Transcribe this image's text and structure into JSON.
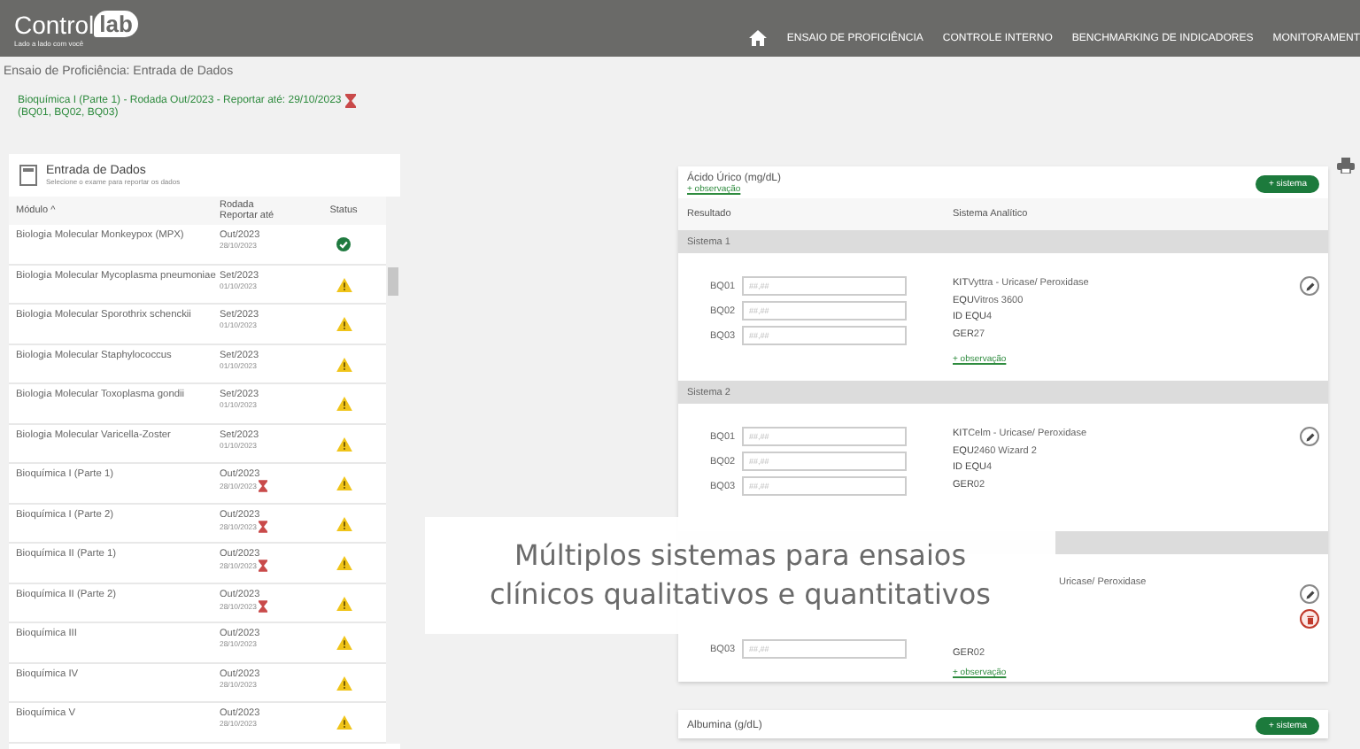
{
  "header": {
    "logo_main": "Control",
    "logo_badge": "lab",
    "tagline": "Lado a lado com você",
    "nav": [
      "ENSAIO DE PROFICIÊNCIA",
      "CONTROLE INTERNO",
      "BENCHMARKING DE INDICADORES",
      "MONITORAMENT"
    ]
  },
  "breadcrumb": "Ensaio de Proficiência: Entrada de Dados",
  "selection": {
    "title": "Bioquímica I (Parte 1) - Rodada Out/2023 - Reportar até: 29/10/2023",
    "deadline_alert": true,
    "samples": "(BQ01, BQ02, BQ03)"
  },
  "panel": {
    "title": "Entrada de Dados",
    "subtitle": "Selecione o exame para reportar os dados",
    "columns": [
      "Módulo ^",
      "Rodada",
      "Reportar até",
      "Status"
    ],
    "rows": [
      {
        "module": "Biologia Molecular Monkeypox (MPX)",
        "round": "Out/2023",
        "date": "28/10/2023",
        "deadline_alert": false,
        "kind": "ok"
      },
      {
        "module": "Biologia Molecular Mycoplasma pneumoniae",
        "round": "Set/2023",
        "date": "01/10/2023",
        "deadline_alert": false,
        "kind": "warning"
      },
      {
        "module": "Biologia Molecular Sporothrix schenckii",
        "round": "Set/2023",
        "date": "01/10/2023",
        "deadline_alert": false,
        "kind": "warning"
      },
      {
        "module": "Biologia Molecular Staphylococcus",
        "round": "Set/2023",
        "date": "01/10/2023",
        "deadline_alert": false,
        "kind": "warning"
      },
      {
        "module": "Biologia Molecular Toxoplasma gondii",
        "round": "Set/2023",
        "date": "01/10/2023",
        "deadline_alert": false,
        "kind": "warning"
      },
      {
        "module": "Biologia Molecular Varicella-Zoster",
        "round": "Set/2023",
        "date": "01/10/2023",
        "deadline_alert": false,
        "kind": "warning"
      },
      {
        "module": "Bioquímica I (Parte 1)",
        "round": "Out/2023",
        "date": "28/10/2023",
        "deadline_alert": true,
        "kind": "warning"
      },
      {
        "module": "Bioquímica I (Parte 2)",
        "round": "Out/2023",
        "date": "28/10/2023",
        "deadline_alert": true,
        "kind": "warning"
      },
      {
        "module": "Bioquímica II (Parte 1)",
        "round": "Out/2023",
        "date": "28/10/2023",
        "deadline_alert": true,
        "kind": "warning"
      },
      {
        "module": "Bioquímica II (Parte 2)",
        "round": "Out/2023",
        "date": "28/10/2023",
        "deadline_alert": true,
        "kind": "warning"
      },
      {
        "module": "Bioquímica III",
        "round": "Out/2023",
        "date": "28/10/2023",
        "deadline_alert": false,
        "kind": "warning"
      },
      {
        "module": "Bioquímica IV",
        "round": "Out/2023",
        "date": "28/10/2023",
        "deadline_alert": false,
        "kind": "warning"
      },
      {
        "module": "Bioquímica V",
        "round": "Out/2023",
        "date": "28/10/2023",
        "deadline_alert": false,
        "kind": "warning"
      }
    ]
  },
  "analytes": [
    {
      "title": "Ácido Úrico (mg/dL)",
      "observation": "+ observação",
      "add_button": "+ sistema",
      "columns": [
        "Resultado",
        "Sistema Analítico"
      ],
      "systems": [
        {
          "name": "Sistema 1",
          "fields": [
            {
              "label": "BQ01",
              "placeholder": "##,##"
            },
            {
              "label": "BQ02",
              "placeholder": "##,##"
            },
            {
              "label": "BQ03",
              "placeholder": "##,##"
            }
          ],
          "info": [
            {
              "label": "KIT",
              "value": "Vyttra - Uricase/ Peroxidase"
            },
            {
              "label": "EQU",
              "value": "Vitros 3600"
            },
            {
              "label": "ID EQU",
              "value": "4"
            },
            {
              "label": "GER",
              "value": "27"
            }
          ],
          "observation": "+ observação",
          "deletable": false
        },
        {
          "name": "Sistema 2",
          "fields": [
            {
              "label": "BQ01",
              "placeholder": "##,##"
            },
            {
              "label": "BQ02",
              "placeholder": "##,##"
            },
            {
              "label": "BQ03",
              "placeholder": "##,##"
            }
          ],
          "info": [
            {
              "label": "KIT",
              "value": "Celm - Uricase/ Peroxidase"
            },
            {
              "label": "EQU",
              "value": "2460 Wizard 2"
            },
            {
              "label": "ID EQU",
              "value": "4"
            },
            {
              "label": "GER",
              "value": "02"
            }
          ],
          "deletable": false
        },
        {
          "fields": [
            {
              "label": "BQ03",
              "placeholder": "##,##"
            }
          ],
          "info": [
            {
              "value": "Uricase/ Peroxidase"
            },
            {
              "label": "GER",
              "value": "02"
            }
          ],
          "observation": "+ observação",
          "deletable": true
        }
      ]
    },
    {
      "title": "Albumina (g/dL)",
      "add_button": "+ sistema"
    }
  ],
  "caption": [
    "Múltiplos sistemas para ensaios",
    "clínicos qualitativos e quantitativos"
  ]
}
